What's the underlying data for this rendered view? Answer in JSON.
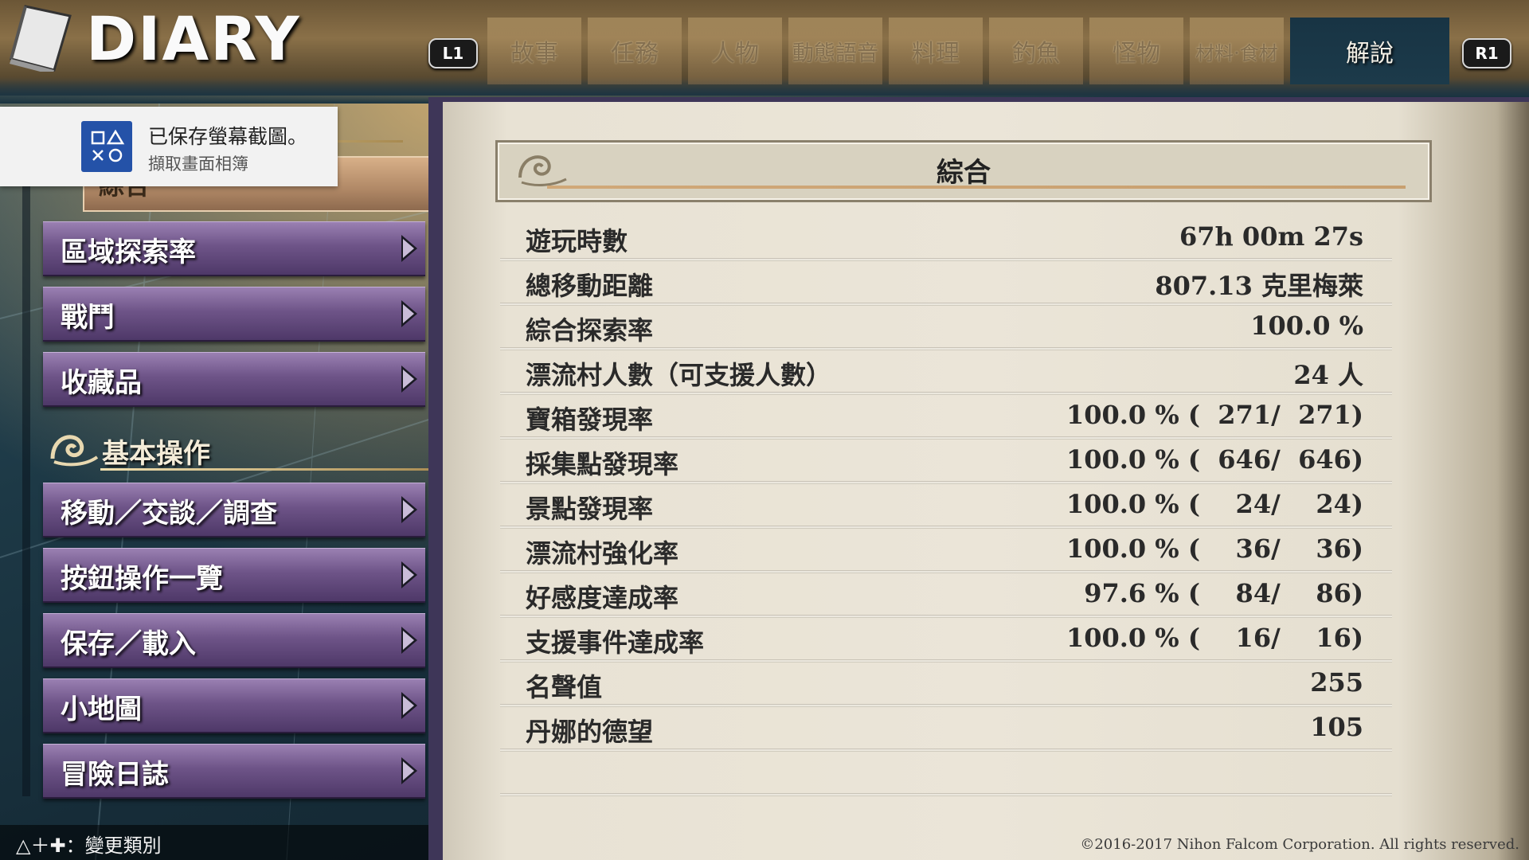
{
  "header": {
    "title": "DIARY",
    "left_button": "L1",
    "right_button": "R1",
    "tabs": [
      {
        "label": "故事"
      },
      {
        "label": "任務"
      },
      {
        "label": "人物"
      },
      {
        "label": "動態語音"
      },
      {
        "label": "料理"
      },
      {
        "label": "釣魚"
      },
      {
        "label": "怪物"
      },
      {
        "label": "材料·食材"
      },
      {
        "label": "解說"
      }
    ]
  },
  "toast": {
    "title": "已保存螢幕截圖。",
    "subtitle": "擷取畫面相簿"
  },
  "sidebar": {
    "selected_label": "綜合",
    "items_group1": [
      {
        "label": "區域探索率"
      },
      {
        "label": "戰鬥"
      },
      {
        "label": "收藏品"
      }
    ],
    "section_title": "基本操作",
    "items_group2": [
      {
        "label": "移動／交談／調查"
      },
      {
        "label": "按鈕操作一覽"
      },
      {
        "label": "保存／載入"
      },
      {
        "label": "小地圖"
      },
      {
        "label": "冒險日誌"
      }
    ]
  },
  "footer": {
    "hint": "△＋✚：變更類別",
    "copyright": "©2016-2017 Nihon Falcom Corporation. All rights reserved."
  },
  "panel": {
    "title": "綜合",
    "rows": [
      {
        "label": "遊玩時數",
        "value": "67h 00m 27s"
      },
      {
        "label": "總移動距離",
        "value": "807.13 克里梅萊"
      },
      {
        "label": "綜合探索率",
        "value": "100.0 %"
      },
      {
        "label": "漂流村人數（可支援人數）",
        "value": "24 人"
      },
      {
        "label": "寶箱發現率",
        "value": "100.0 % (  271/  271)"
      },
      {
        "label": "採集點發現率",
        "value": "100.0 % (  646/  646)"
      },
      {
        "label": "景點發現率",
        "value": "100.0 % (    24/    24)"
      },
      {
        "label": "漂流村強化率",
        "value": "100.0 % (    36/    36)"
      },
      {
        "label": "好感度達成率",
        "value": "97.6 % (    84/    86)"
      },
      {
        "label": "支援事件達成率",
        "value": "100.0 % (    16/    16)"
      },
      {
        "label": "名聲值",
        "value": "255"
      },
      {
        "label": "丹娜的德望",
        "value": "105"
      }
    ]
  }
}
